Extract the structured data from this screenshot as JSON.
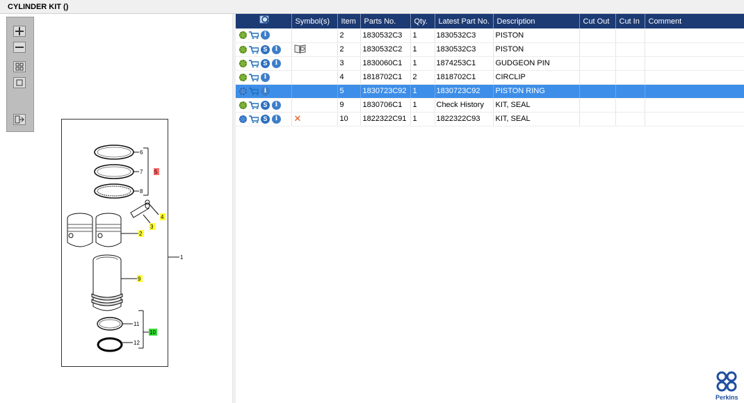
{
  "window": {
    "title": "CYLINDER KIT ()"
  },
  "viewer_toolbar": {
    "buttons": [
      {
        "icon": "zoom-in-icon"
      },
      {
        "icon": "zoom-out-icon"
      },
      {
        "icon": "fit-all-icon"
      },
      {
        "icon": "fit-window-icon"
      },
      {
        "icon": "export-icon"
      }
    ]
  },
  "diagram": {
    "callouts": [
      "6",
      "7",
      "5",
      "8",
      "4",
      "3",
      "2",
      "1",
      "9",
      "11",
      "10",
      "12"
    ],
    "highlight_colors": {
      "red": "#ff6b6b",
      "yellow": "#ffff33",
      "green": "#33dd33"
    }
  },
  "grid": {
    "columns": [
      "",
      "Symbol(s)",
      "Item",
      "Parts No.",
      "Qty.",
      "Latest Part No.",
      "Description",
      "Cut Out",
      "Cut In",
      "Comment"
    ],
    "rows": [
      {
        "icons": [
          "gear",
          "cart",
          "info"
        ],
        "symbol": "",
        "item": "2",
        "part_no": "1830532C3",
        "qty": "1",
        "latest": "1830532C3",
        "desc": "PISTON",
        "cut_out": "",
        "cut_in": "",
        "comment": ""
      },
      {
        "icons": [
          "gear",
          "cart",
          "s",
          "info"
        ],
        "symbol": "book",
        "item": "2",
        "part_no": "1830532C2",
        "qty": "1",
        "latest": "1830532C3",
        "desc": "PISTON",
        "cut_out": "",
        "cut_in": "",
        "comment": ""
      },
      {
        "icons": [
          "gear",
          "cart",
          "s",
          "info"
        ],
        "symbol": "",
        "item": "3",
        "part_no": "1830060C1",
        "qty": "1",
        "latest": "1874253C1",
        "desc": "GUDGEON PIN",
        "cut_out": "",
        "cut_in": "",
        "comment": ""
      },
      {
        "icons": [
          "gear",
          "cart",
          "info"
        ],
        "symbol": "",
        "item": "4",
        "part_no": "1818702C1",
        "qty": "2",
        "latest": "1818702C1",
        "desc": "CIRCLIP",
        "cut_out": "",
        "cut_in": "",
        "comment": ""
      },
      {
        "icons": [
          "gear-blue",
          "cart",
          "info"
        ],
        "symbol": "",
        "item": "5",
        "part_no": "1830723C92",
        "qty": "1",
        "latest": "1830723C92",
        "desc": "PISTON RING",
        "cut_out": "",
        "cut_in": "",
        "comment": "",
        "selected": true
      },
      {
        "icons": [
          "gear",
          "cart",
          "s",
          "info"
        ],
        "symbol": "",
        "item": "9",
        "part_no": "1830706C1",
        "qty": "1",
        "latest": "Check History",
        "desc": "KIT, SEAL",
        "cut_out": "",
        "cut_in": "",
        "comment": ""
      },
      {
        "icons": [
          "gear-blue",
          "cart",
          "s",
          "info"
        ],
        "symbol": "x",
        "item": "10",
        "part_no": "1822322C91",
        "qty": "1",
        "latest": "1822322C93",
        "desc": "KIT, SEAL",
        "cut_out": "",
        "cut_in": "",
        "comment": ""
      }
    ]
  },
  "brand": {
    "name": "Perkins",
    "color": "#1f4fa0"
  },
  "colors": {
    "header_bg": "#1c3a73",
    "selected_row": "#3d8ee8"
  }
}
